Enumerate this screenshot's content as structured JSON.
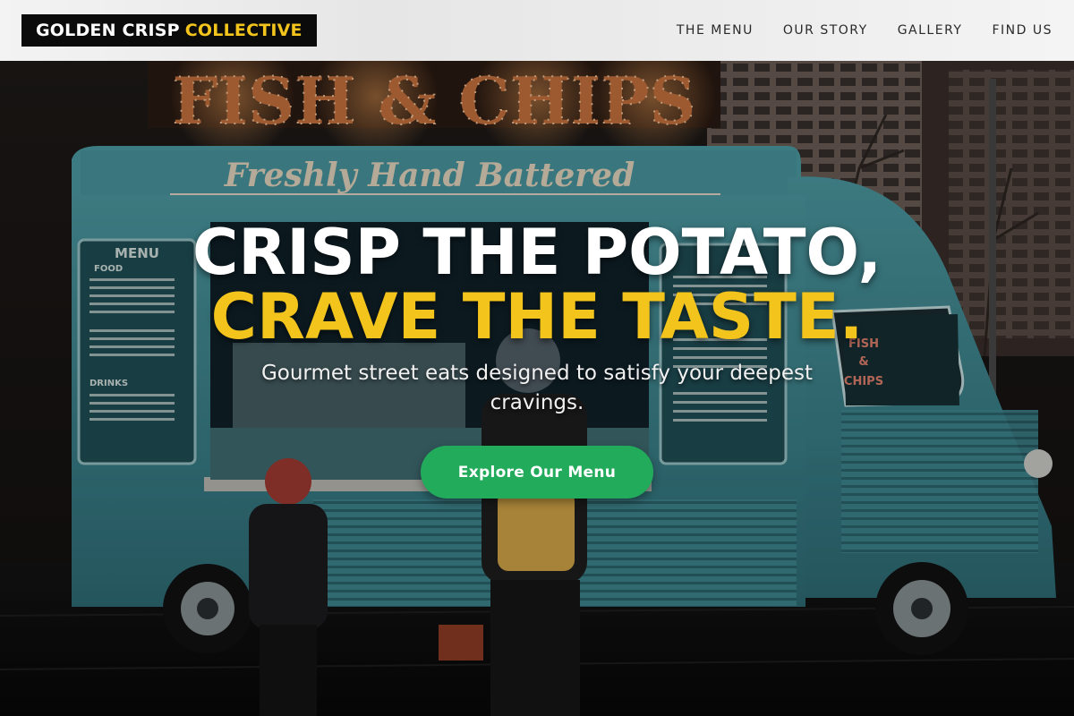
{
  "header": {
    "brand_part1": "GOLDEN CRISP",
    "brand_part2": "COLLECTIVE",
    "nav": [
      {
        "label": "THE MENU"
      },
      {
        "label": "OUR STORY"
      },
      {
        "label": "GALLERY"
      },
      {
        "label": "FIND US"
      }
    ]
  },
  "hero": {
    "headline_line1": "CRISP THE POTATO,",
    "headline_line2": "CRAVE THE TASTE.",
    "subtitle": "Gourmet street eats designed to satisfy your deepest cravings.",
    "cta_label": "Explore Our Menu"
  },
  "background_photo": {
    "sign_text": "FISH & CHIPS",
    "banner_text": "Freshly Hand Battered",
    "menu_title": "MENU",
    "menu_sections": [
      "FOOD",
      "DRINKS"
    ],
    "side_window_text": [
      "FISH",
      "&",
      "CHIPS"
    ]
  },
  "colors": {
    "accent_yellow": "#f2c41c",
    "cta_green": "#23ab5c",
    "truck_teal": "#4e9ea6",
    "logo_bg": "#0b0b0b"
  }
}
